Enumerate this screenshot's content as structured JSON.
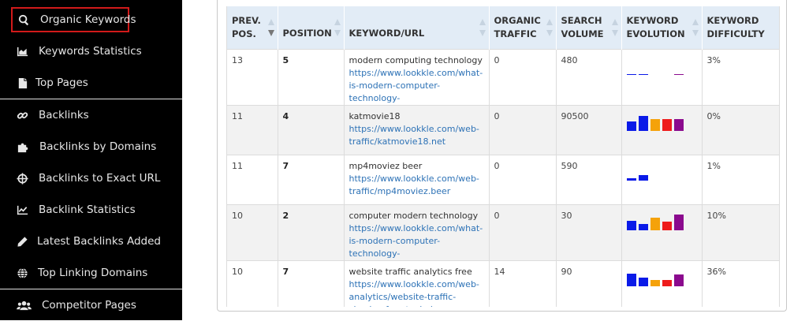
{
  "sidebar": {
    "items": [
      {
        "label": "Organic Keywords",
        "icon": "search-icon"
      },
      {
        "label": "Keywords Statistics",
        "icon": "area-chart-icon"
      },
      {
        "label": "Top Pages",
        "icon": "file-icon"
      },
      {
        "label": "Backlinks",
        "icon": "link-icon"
      },
      {
        "label": "Backlinks by Domains",
        "icon": "puzzle-icon"
      },
      {
        "label": "Backlinks to Exact URL",
        "icon": "crosshair-icon"
      },
      {
        "label": "Backlink Statistics",
        "icon": "line-chart-icon"
      },
      {
        "label": "Latest Backlinks Added",
        "icon": "pencil-icon"
      },
      {
        "label": "Top Linking Domains",
        "icon": "globe-icon"
      },
      {
        "label": "Competitor Pages",
        "icon": "users-icon"
      }
    ]
  },
  "table": {
    "headers": {
      "prev_pos": "PREV. POS.",
      "position": "POSITION",
      "keyword_url": "KEYWORD/URL",
      "organic_traffic": "ORGANIC TRAFFIC",
      "search_volume": "SEARCH VOLUME",
      "keyword_evolution": "KEYWORD EVOLUTION",
      "keyword_difficulty": "KEYWORD DIFFICULTY"
    },
    "rows": [
      {
        "prev_pos": "13",
        "position": "5",
        "keyword": "modern computing technology",
        "url": "https://www.lookkle.com/what-is-modern-computer-technology-",
        "organic_traffic": "0",
        "search_volume": "480",
        "difficulty": "3%",
        "evolution": [
          0.05,
          0.05,
          0,
          0,
          0.05
        ]
      },
      {
        "prev_pos": "11",
        "position": "4",
        "keyword": "katmovie18",
        "url": "https://www.lookkle.com/web-traffic/katmovie18.net",
        "organic_traffic": "0",
        "search_volume": "90500",
        "difficulty": "0%",
        "evolution": [
          0.62,
          0.95,
          0.75,
          0.75,
          0.75
        ]
      },
      {
        "prev_pos": "11",
        "position": "7",
        "keyword": "mp4moviez beer",
        "url": "https://www.lookkle.com/web-traffic/mp4moviez.beer",
        "organic_traffic": "0",
        "search_volume": "590",
        "difficulty": "1%",
        "evolution": [
          0.15,
          0.35,
          0,
          0,
          0
        ]
      },
      {
        "prev_pos": "10",
        "position": "2",
        "keyword": "computer modern technology",
        "url": "https://www.lookkle.com/what-is-modern-computer-technology-",
        "organic_traffic": "0",
        "search_volume": "30",
        "difficulty": "10%",
        "evolution": [
          0.6,
          0.4,
          0.8,
          0.55,
          1.0
        ]
      },
      {
        "prev_pos": "10",
        "position": "7",
        "keyword": "website traffic analytics free",
        "url": "https://www.lookkle.com/web-analytics/website-traffic-checker-free-tool.php",
        "organic_traffic": "14",
        "search_volume": "90",
        "difficulty": "36%",
        "evolution": [
          0.8,
          0.55,
          0.4,
          0.4,
          0.75
        ]
      }
    ],
    "evolution_colors": [
      "#0a1ae8",
      "#0a1ae8",
      "#f5a20a",
      "#ee1c1c",
      "#8b0a8e"
    ],
    "row_heights": [
      63,
      63,
      63,
      63,
      76
    ]
  }
}
